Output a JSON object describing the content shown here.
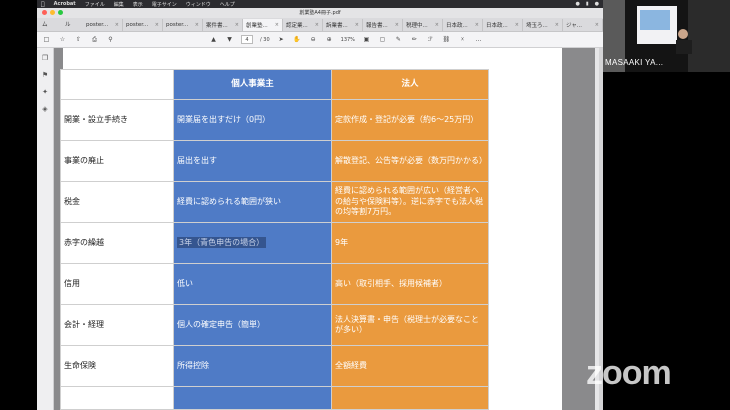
{
  "menubar": {
    "app": "Acrobat",
    "items": [
      "ファイル",
      "編集",
      "表示",
      "電子サイン",
      "ウィンドウ",
      "ヘルプ"
    ]
  },
  "window": {
    "title": "創業塾A4冊子.pdf"
  },
  "tabbar": {
    "nav": [
      "ホーム",
      "ツール"
    ],
    "tabs": [
      {
        "label": "poster..."
      },
      {
        "label": "poster..."
      },
      {
        "label": "poster..."
      },
      {
        "label": "案件書..."
      },
      {
        "label": "創業塾..."
      },
      {
        "label": "認定業..."
      },
      {
        "label": "訴業書..."
      },
      {
        "label": "報告書..."
      },
      {
        "label": "税理中..."
      },
      {
        "label": "日本政..."
      },
      {
        "label": "日本政..."
      },
      {
        "label": "埼玉ろ..."
      },
      {
        "label": "ジャ..."
      }
    ],
    "active_index": 4
  },
  "toolbar": {
    "page_current": "4",
    "page_total": "/ 30",
    "zoom": "137%"
  },
  "document": {
    "headers": [
      "",
      "個人事業主",
      "法人"
    ],
    "rows": [
      {
        "label": "開業・設立手続き",
        "a": "開業届を出すだけ（0円）",
        "b": "定款作成・登記が必要（約6～25万円）"
      },
      {
        "label": "事業の廃止",
        "a": "届出を出す",
        "b": "解散登記、公告等が必要（数万円かかる）"
      },
      {
        "label": "税金",
        "a": "経費に認められる範囲が狭い",
        "b": "経費に認められる範囲が広い（経営者への給与や保険料等）。逆に赤字でも法人税の均等割7万円。"
      },
      {
        "label": "赤字の繰越",
        "a": "3年（青色申告の場合）",
        "b": "9年"
      },
      {
        "label": "信用",
        "a": "低い",
        "b": "高い（取引相手、採用候補者）"
      },
      {
        "label": "会計・経理",
        "a": "個人の確定申告（簡単）",
        "b": "法人決算書・申告（税理士が必要なことが多い）"
      },
      {
        "label": "生命保険",
        "a": "所得控除",
        "b": "全額経費"
      },
      {
        "label": "",
        "a": "",
        "b": ""
      }
    ],
    "page_size": "210 x 300 mm"
  },
  "video": {
    "speaker_name": "MASAAKI YA..."
  },
  "watermark": "zoom",
  "colors": {
    "sole_proprietor": "#4f7bc6",
    "corporation": "#ea9a3e"
  }
}
